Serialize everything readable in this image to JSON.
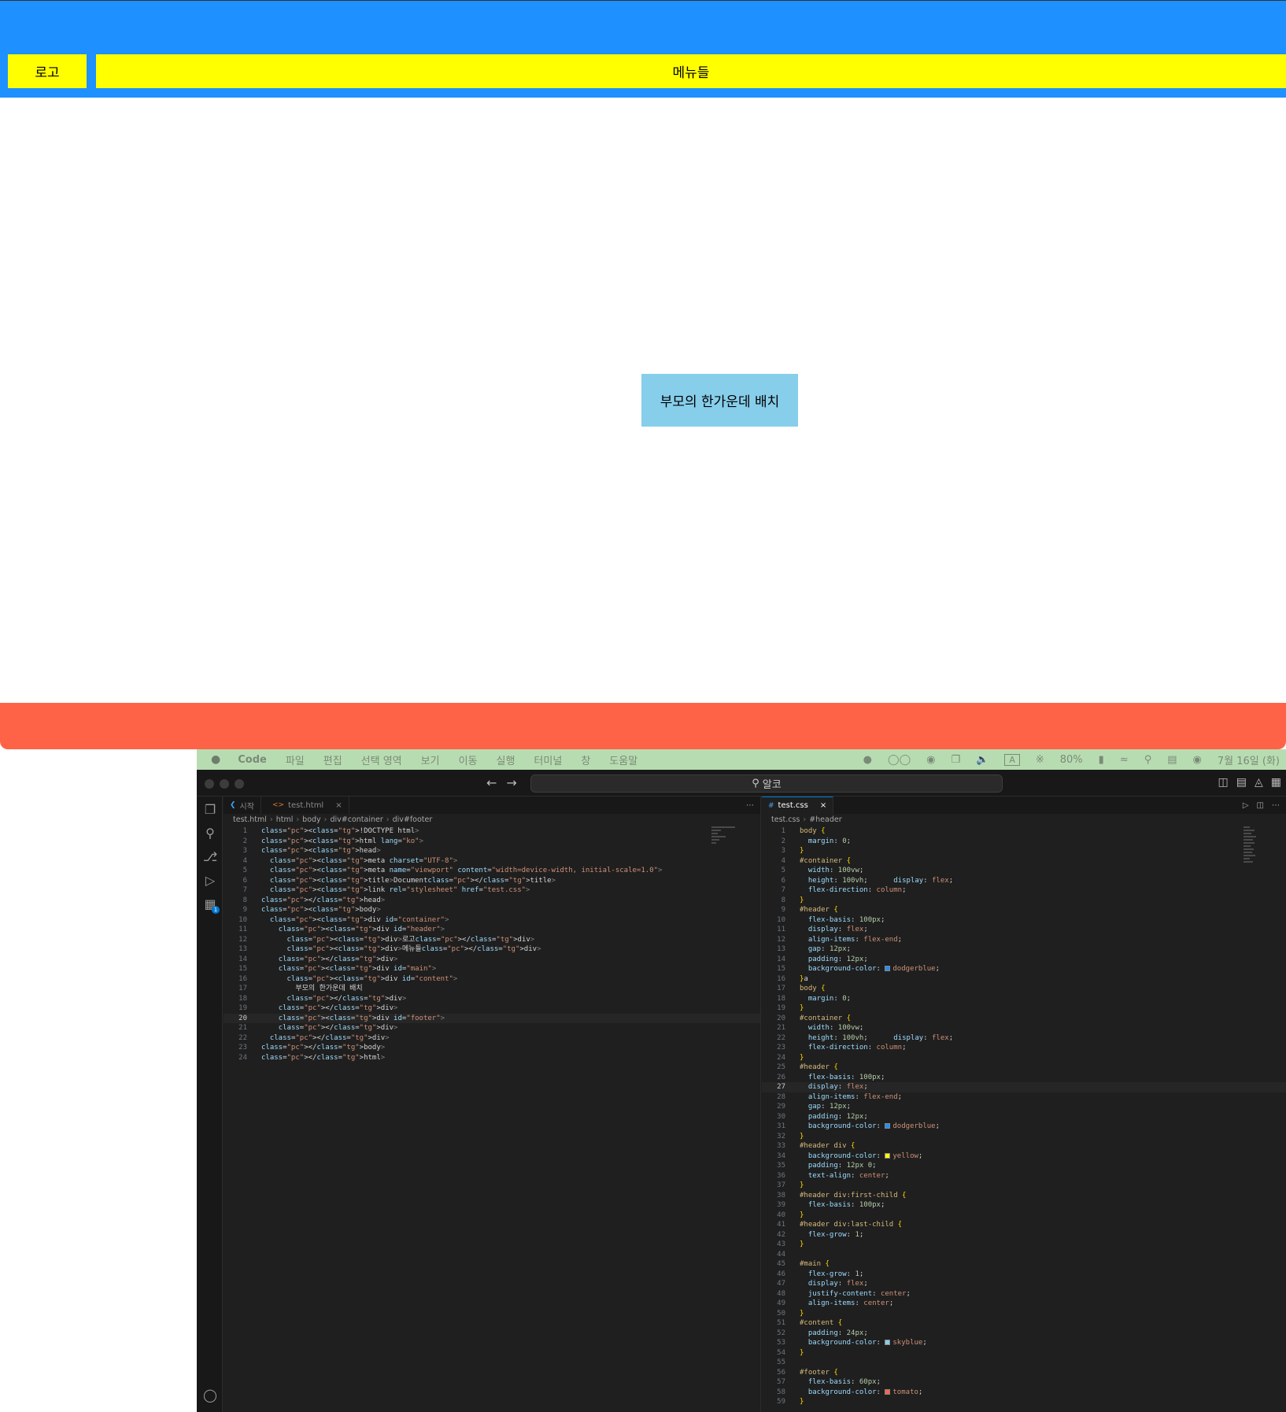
{
  "browser": {
    "logo": "로고",
    "menus": "메뉴들",
    "content": "부모의 한가운데 배치",
    "colors": {
      "header": "#1e90ff",
      "box": "#ffff00",
      "content": "#87ceeb",
      "footer": "#ff6347"
    }
  },
  "menubar": {
    "apple_icon": "apple-icon",
    "app": "Code",
    "items": [
      "파일",
      "편집",
      "선택 영역",
      "보기",
      "이동",
      "실행",
      "터미널",
      "창",
      "도움말"
    ],
    "battery": "80%",
    "input_source": "A",
    "datetime": "7월 16일 (화)"
  },
  "vscode": {
    "search": "알코",
    "left": {
      "tabs": [
        {
          "label": "시작",
          "active": false
        },
        {
          "label": "test.html",
          "active": false,
          "close": "×"
        }
      ],
      "breadcrumbs": [
        "test.html",
        "html",
        "body",
        "div#container",
        "div#footer"
      ],
      "current_line": 20,
      "lines": [
        "<!DOCTYPE html>",
        "<html lang=\"ko\">",
        "<head>",
        "  <meta charset=\"UTF-8\">",
        "  <meta name=\"viewport\" content=\"width=device-width, initial-scale=1.0\">",
        "  <title>Document</title>",
        "  <link rel=\"stylesheet\" href=\"test.css\">",
        "</head>",
        "<body>",
        "  <div id=\"container\">",
        "    <div id=\"header\">",
        "      <div>로고</div>",
        "      <div>메뉴들</div>",
        "    </div>",
        "    <div id=\"main\">",
        "      <div id=\"content\">",
        "        부모의 한가운데 배치",
        "      </div>",
        "    </div>",
        "    <div id=\"footer\">",
        "    </div>",
        "  </div>",
        "</body>",
        "</html>"
      ]
    },
    "right": {
      "tabs": [
        {
          "label": "test.css",
          "active": true,
          "close": "×"
        }
      ],
      "breadcrumbs": [
        "test.css",
        "#header"
      ],
      "current_line": 27,
      "lines": [
        "body {",
        "  margin: 0;",
        "}",
        "#container {",
        "  width: 100vw;",
        "  height: 100vh;      display: flex;",
        "  flex-direction: column;",
        "}",
        "#header {",
        "  flex-basis: 100px;",
        "  display: flex;",
        "  align-items: flex-end;",
        "  gap: 12px;",
        "  padding: 12px;",
        "  background-color: dodgerblue;",
        "}a",
        "body {",
        "  margin: 0;",
        "}",
        "#container {",
        "  width: 100vw;",
        "  height: 100vh;      display: flex;",
        "  flex-direction: column;",
        "}",
        "#header {",
        "  flex-basis: 100px;",
        "  display: flex;",
        "  align-items: flex-end;",
        "  gap: 12px;",
        "  padding: 12px;",
        "  background-color: dodgerblue;",
        "}",
        "#header div {",
        "  background-color: yellow;",
        "  padding: 12px 0;",
        "  text-align: center;",
        "}",
        "#header div:first-child {",
        "  flex-basis: 100px;",
        "}",
        "#header div:last-child {",
        "  flex-grow: 1;",
        "}",
        "",
        "#main {",
        "  flex-grow: 1;",
        "  display: flex;",
        "  justify-content: center;",
        "  align-items: center;",
        "}",
        "#content {",
        "  padding: 24px;",
        "  background-color: skyblue;",
        "}",
        "",
        "#footer {",
        "  flex-basis: 60px;",
        "  background-color: tomato;",
        "}"
      ]
    }
  }
}
